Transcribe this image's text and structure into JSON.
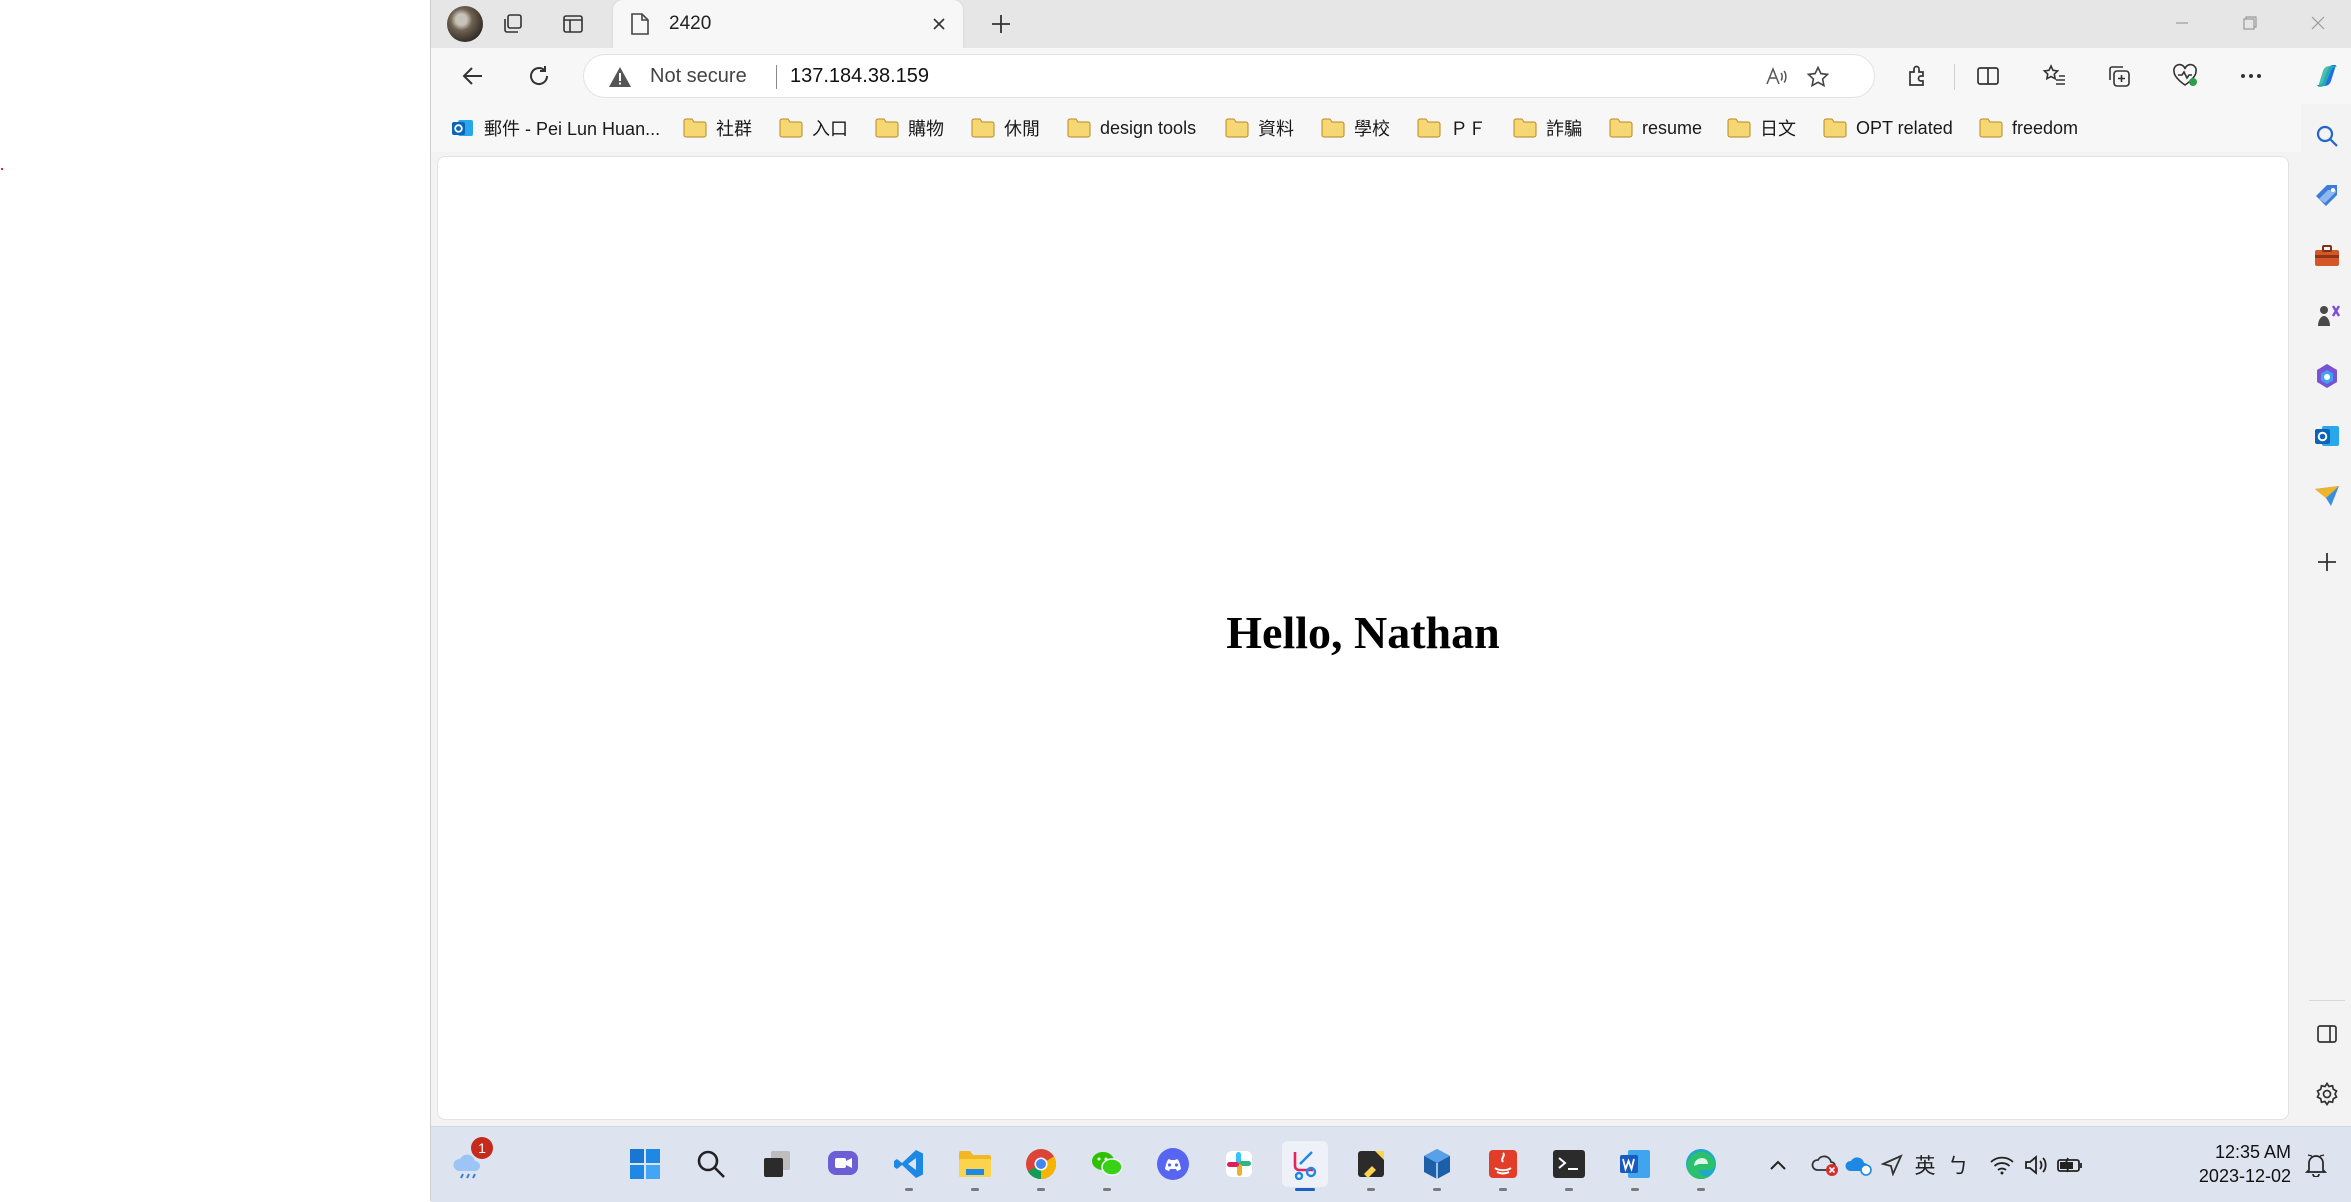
{
  "tab": {
    "title": "2420"
  },
  "address": {
    "security_label": "Not secure",
    "url": "137.184.38.159"
  },
  "favorites": [
    {
      "label": "郵件 - Pei Lun Huan...",
      "icon": "outlook-icon"
    },
    {
      "label": "社群",
      "icon": "folder-icon"
    },
    {
      "label": "入口",
      "icon": "folder-icon"
    },
    {
      "label": "購物",
      "icon": "folder-icon"
    },
    {
      "label": "休閒",
      "icon": "folder-icon"
    },
    {
      "label": "design tools",
      "icon": "folder-icon"
    },
    {
      "label": "資料",
      "icon": "folder-icon"
    },
    {
      "label": "學校",
      "icon": "folder-icon"
    },
    {
      "label": "ＰＦ",
      "icon": "folder-icon"
    },
    {
      "label": "詐騙",
      "icon": "folder-icon"
    },
    {
      "label": "resume",
      "icon": "folder-icon"
    },
    {
      "label": "日文",
      "icon": "folder-icon"
    },
    {
      "label": "OPT related",
      "icon": "folder-icon"
    },
    {
      "label": "freedom",
      "icon": "folder-icon"
    }
  ],
  "page": {
    "heading": "Hello, Nathan"
  },
  "taskbar": {
    "widgets_badge": "1",
    "apps": [
      "start",
      "search",
      "task-view",
      "teams",
      "vscode",
      "file-explorer",
      "chrome",
      "wechat",
      "discord",
      "slack",
      "snipping-tool",
      "sticky-notes",
      "virtualbox",
      "java",
      "terminal",
      "word",
      "edge"
    ]
  },
  "tray": {
    "ime_mode": "英",
    "ime_input": "ㄅ"
  },
  "clock": {
    "time": "12:35 AM",
    "date": "2023-12-02"
  },
  "colors": {
    "taskbar": "#dde4ef",
    "folder": "#f2c94c",
    "accent": "#1f5fbf"
  }
}
